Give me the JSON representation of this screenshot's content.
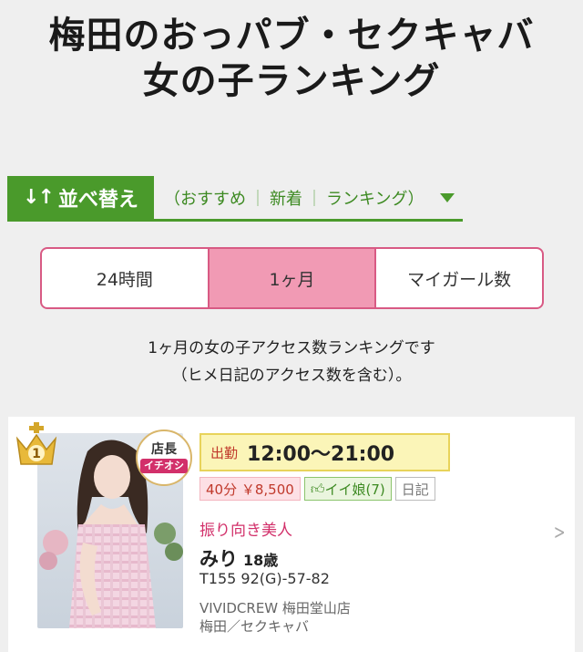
{
  "header": {
    "title_line1": "梅田のおっパブ・セクキャバ",
    "title_line2": "女の子ランキング"
  },
  "sort": {
    "label": "並べ替え",
    "icon": "sort-arrows-icon",
    "open_paren": "（",
    "options": [
      "おすすめ",
      "新着",
      "ランキング"
    ],
    "close_paren": "）",
    "separator": "｜"
  },
  "tabs": {
    "items": [
      "24時間",
      "1ヶ月",
      "マイガール数"
    ],
    "active_index": 1
  },
  "description": {
    "line1": "1ヶ月の女の子アクセス数ランキングです",
    "line2": "（ヒメ日記のアクセス数を含む）。"
  },
  "card": {
    "rank": "1",
    "badge_line1": "店長",
    "badge_line2": "イチオシ",
    "shift_label": "出勤",
    "shift_time": "12:00〜21:00",
    "price": "40分 ￥8,500",
    "like": "イイ娘(7)",
    "diary": "日記",
    "catch": "振り向き美人",
    "name": "みり",
    "age": "18歳",
    "specs": "T155 92(G)-57-82",
    "shop": "VIVIDCREW 梅田堂山店",
    "area": "梅田／セクキャバ"
  },
  "colors": {
    "green": "#4a9a2b",
    "pink_border": "#d85a84",
    "pink_active": "#f19ab4",
    "shift_bg": "#fbf5b8",
    "accent_red": "#d2306a"
  }
}
